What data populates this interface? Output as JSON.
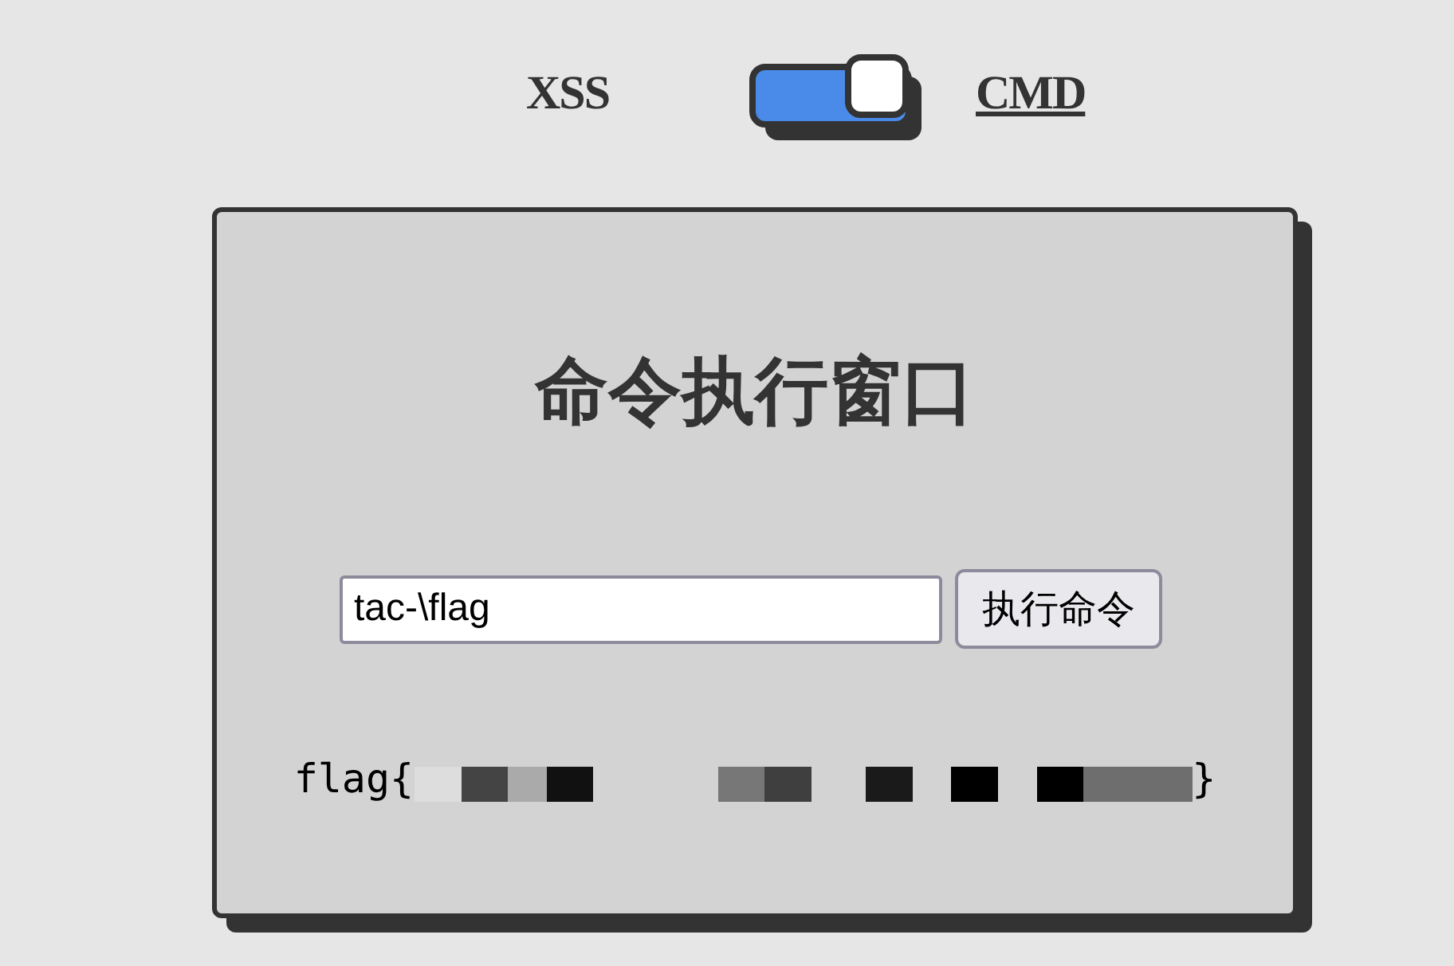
{
  "mode_switch": {
    "options": [
      {
        "label": "XSS",
        "selected": false
      },
      {
        "label": "CMD",
        "selected": true
      }
    ],
    "on": true
  },
  "panel": {
    "title": "命令执行窗口",
    "command_input": {
      "value": "tac-\\flag"
    },
    "run_button": "执行命令",
    "output": {
      "prefix": "flag{",
      "suffix": "}",
      "redacted": true
    }
  }
}
